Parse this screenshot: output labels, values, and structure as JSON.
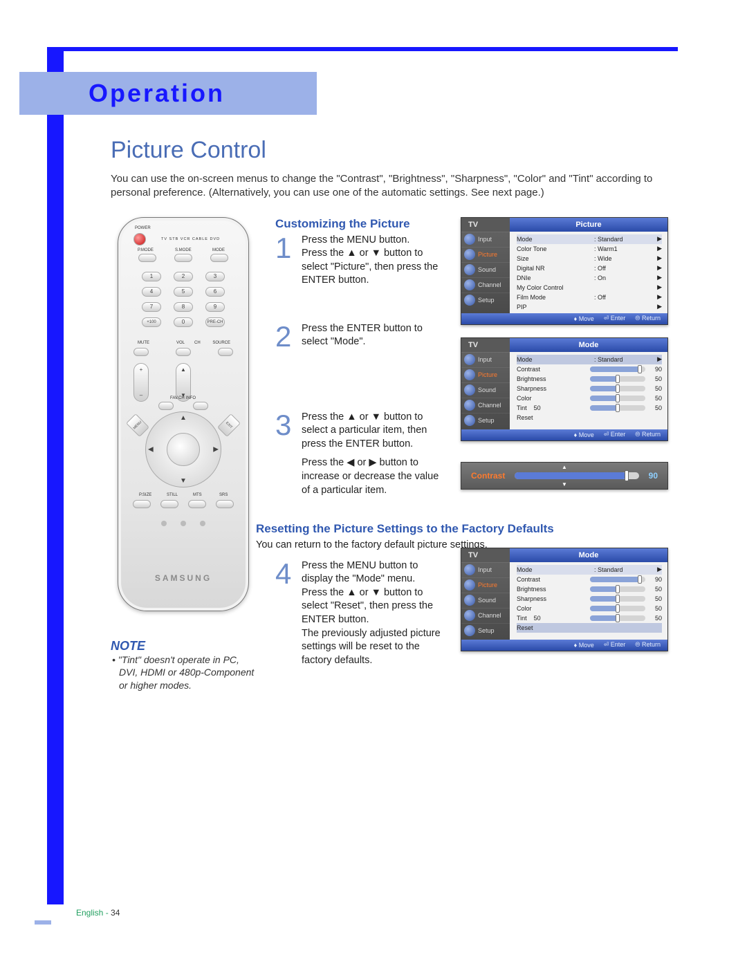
{
  "tab": {
    "title": "Operation"
  },
  "section": {
    "title": "Picture Control",
    "intro": "You can use the on-screen menus to change the \"Contrast\", \"Brightness\", \"Sharpness\", \"Color\" and \"Tint\" according to personal preference. (Alternatively, you can use one of the automatic settings. See next page.)"
  },
  "remote": {
    "power": "POWER",
    "device_labels": "TV  STB  VCR  CABLE  DVD",
    "mode_row": [
      "P.MODE",
      "S.MODE",
      "MODE"
    ],
    "numpad": [
      "1",
      "2",
      "3",
      "4",
      "5",
      "6",
      "7",
      "8",
      "9",
      "+100",
      "0",
      "PRE-CH"
    ],
    "mute": "MUTE",
    "vol": "VOL",
    "ch": "CH",
    "source": "SOURCE",
    "favch": "FAV.CH",
    "info": "INFO",
    "menu": "MENU",
    "exit": "EXIT",
    "enter": "ENTER",
    "bottom_row": [
      "P.SIZE",
      "STILL",
      "MTS",
      "SRS"
    ],
    "brand": "SAMSUNG"
  },
  "note": {
    "head": "NOTE",
    "body": "• \"Tint\" doesn't operate in PC, DVI, HDMI or 480p-Component or higher modes."
  },
  "subheads": {
    "customizing": "Customizing the Picture",
    "resetting": "Resetting the Picture Settings to the Factory Defaults",
    "resetting_intro": "You can return to the factory default picture settings."
  },
  "steps": {
    "s1": "Press the MENU button.\nPress the ▲ or ▼ button to select \"Picture\", then press the ENTER button.",
    "s2": "Press the ENTER button to select \"Mode\".",
    "s3a": "Press the ▲ or ▼ button to select a particular item, then press the ENTER button.",
    "s3b": "Press the ◀ or ▶ button to increase or decrease the value of a particular item.",
    "s4": "Press the MENU button to display the \"Mode\" menu. Press the ▲ or ▼ button to select \"Reset\", then press the ENTER button.\nThe previously adjusted picture settings will be reset to the factory defaults."
  },
  "osd": {
    "tv": "TV",
    "side": [
      "Input",
      "Picture",
      "Sound",
      "Channel",
      "Setup"
    ],
    "foot": {
      "move": "Move",
      "enter": "Enter",
      "return": "Return"
    },
    "picture": {
      "title": "Picture",
      "rows": [
        {
          "k": "Mode",
          "v": ": Standard",
          "car": "▶"
        },
        {
          "k": "Color Tone",
          "v": ": Warm1",
          "car": "▶"
        },
        {
          "k": "Size",
          "v": ": Wide",
          "car": "▶"
        },
        {
          "k": "Digital NR",
          "v": ": Off",
          "car": "▶"
        },
        {
          "k": "DNIe",
          "v": ": On",
          "car": "▶"
        },
        {
          "k": "My Color Control",
          "v": "",
          "car": "▶"
        },
        {
          "k": "Film Mode",
          "v": ": Off",
          "car": "▶"
        },
        {
          "k": "PIP",
          "v": "",
          "car": "▶"
        }
      ]
    },
    "mode": {
      "title": "Mode",
      "rows": [
        {
          "k": "Mode",
          "v": ": Standard",
          "car": "▶"
        },
        {
          "k": "Contrast",
          "slider": 90,
          "val": "90"
        },
        {
          "k": "Brightness",
          "slider": 50,
          "val": "50"
        },
        {
          "k": "Sharpness",
          "slider": 50,
          "val": "50"
        },
        {
          "k": "Color",
          "slider": 50,
          "val": "50"
        },
        {
          "k": "Tint",
          "tint_l": "50",
          "slider": 50,
          "val": "50"
        },
        {
          "k": "Reset",
          "v": "",
          "car": ""
        }
      ]
    },
    "strip": {
      "label": "Contrast",
      "value": "90",
      "pct": 90
    }
  },
  "footer": {
    "lang": "English",
    "sep": " - ",
    "page": "34"
  }
}
